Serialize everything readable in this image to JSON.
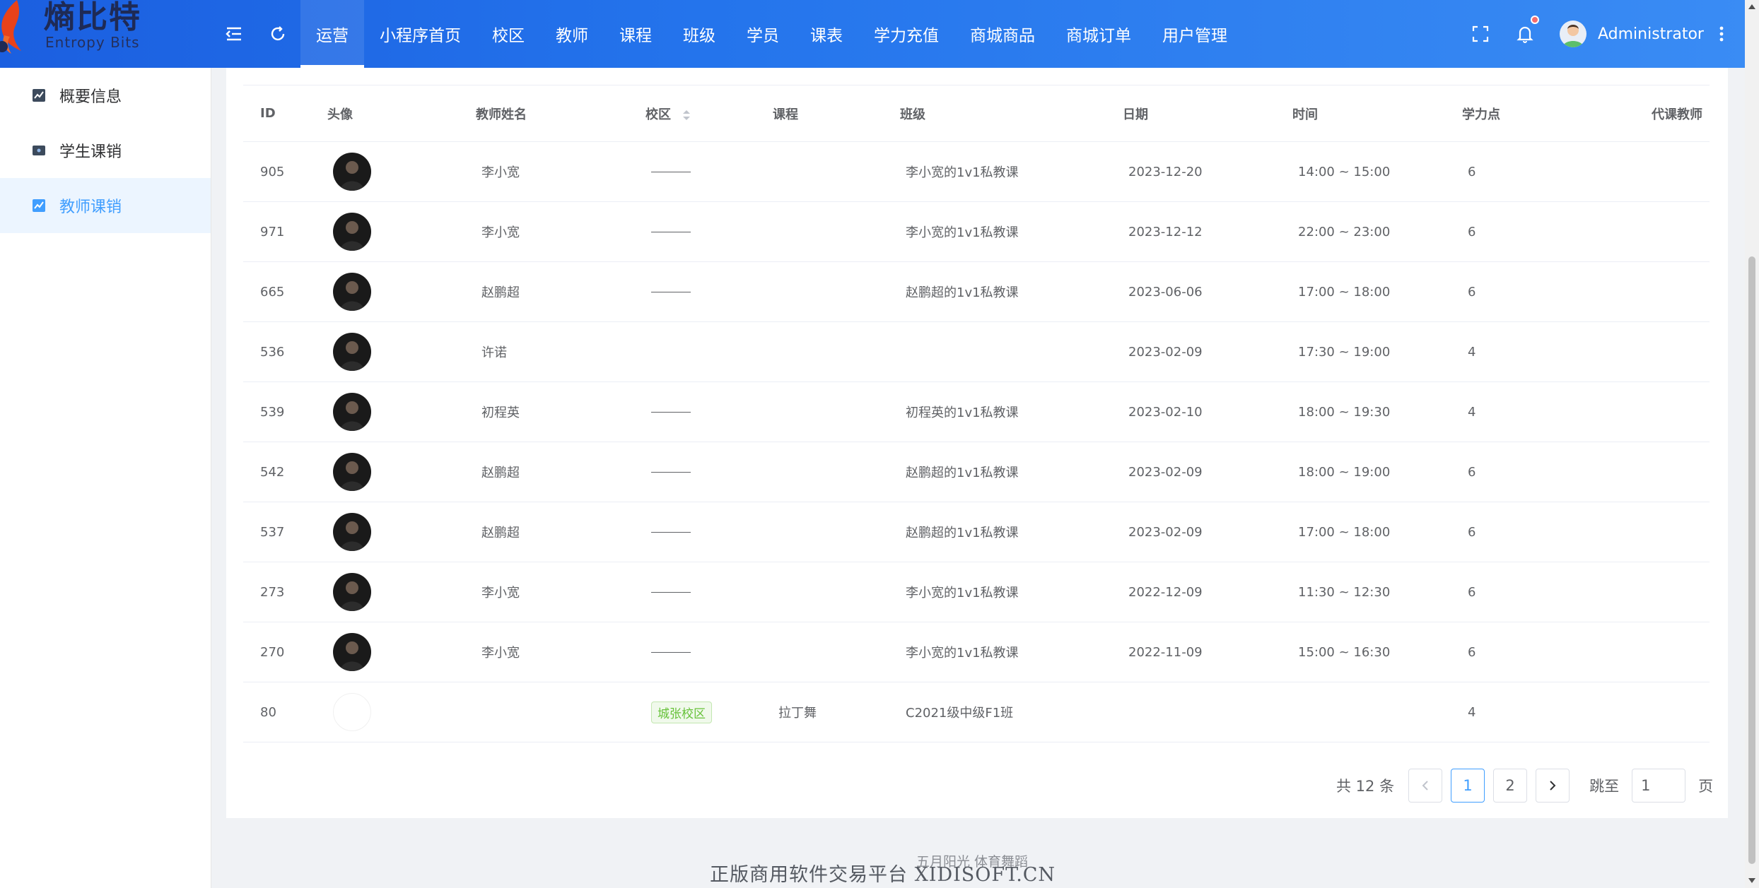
{
  "brand": {
    "title": "熵比特",
    "subtitle": "Entropy Bits"
  },
  "header": {
    "nav": [
      {
        "label": "运营",
        "active": true
      },
      {
        "label": "小程序首页"
      },
      {
        "label": "校区"
      },
      {
        "label": "教师"
      },
      {
        "label": "课程"
      },
      {
        "label": "班级"
      },
      {
        "label": "学员"
      },
      {
        "label": "课表"
      },
      {
        "label": "学力充值"
      },
      {
        "label": "商城商品"
      },
      {
        "label": "商城订单"
      },
      {
        "label": "用户管理"
      }
    ],
    "user_name": "Administrator",
    "icons": [
      "menu-fold-icon",
      "refresh-icon",
      "fullscreen-icon",
      "bell-icon",
      "more-vertical-icon"
    ]
  },
  "sidebar": {
    "items": [
      {
        "label": "概要信息",
        "icon": "trend-chart-icon"
      },
      {
        "label": "学生课销",
        "icon": "id-card-icon"
      },
      {
        "label": "教师课销",
        "icon": "trend-chart-icon",
        "active": true
      }
    ]
  },
  "table": {
    "columns": [
      "ID",
      "头像",
      "教师姓名",
      "校区",
      "课程",
      "班级",
      "日期",
      "时间",
      "学力点",
      "代课教师"
    ],
    "rows": [
      {
        "id": "905",
        "teacher": "李小宽",
        "campus": "———",
        "course": "",
        "class": "李小宽的1v1私教课",
        "date": "2023-12-20",
        "time": "14:00 ~ 15:00",
        "points": "6",
        "substitute": ""
      },
      {
        "id": "971",
        "teacher": "李小宽",
        "campus": "———",
        "course": "",
        "class": "李小宽的1v1私教课",
        "date": "2023-12-12",
        "time": "22:00 ~ 23:00",
        "points": "6",
        "substitute": ""
      },
      {
        "id": "665",
        "teacher": "赵鹏超",
        "campus": "———",
        "course": "",
        "class": "赵鹏超的1v1私教课",
        "date": "2023-06-06",
        "time": "17:00 ~ 18:00",
        "points": "6",
        "substitute": ""
      },
      {
        "id": "536",
        "teacher": "许诺",
        "campus": "",
        "course": "",
        "class": "",
        "date": "2023-02-09",
        "time": "17:30 ~ 19:00",
        "points": "4",
        "substitute": ""
      },
      {
        "id": "539",
        "teacher": "初程英",
        "campus": "———",
        "course": "",
        "class": "初程英的1v1私教课",
        "date": "2023-02-10",
        "time": "18:00 ~ 19:30",
        "points": "4",
        "substitute": ""
      },
      {
        "id": "542",
        "teacher": "赵鹏超",
        "campus": "———",
        "course": "",
        "class": "赵鹏超的1v1私教课",
        "date": "2023-02-09",
        "time": "18:00 ~ 19:00",
        "points": "6",
        "substitute": ""
      },
      {
        "id": "537",
        "teacher": "赵鹏超",
        "campus": "———",
        "course": "",
        "class": "赵鹏超的1v1私教课",
        "date": "2023-02-09",
        "time": "17:00 ~ 18:00",
        "points": "6",
        "substitute": ""
      },
      {
        "id": "273",
        "teacher": "李小宽",
        "campus": "———",
        "course": "",
        "class": "李小宽的1v1私教课",
        "date": "2022-12-09",
        "time": "11:30 ~ 12:30",
        "points": "6",
        "substitute": ""
      },
      {
        "id": "270",
        "teacher": "李小宽",
        "campus": "———",
        "course": "",
        "class": "李小宽的1v1私教课",
        "date": "2022-11-09",
        "time": "15:00 ~ 16:30",
        "points": "6",
        "substitute": ""
      },
      {
        "id": "80",
        "teacher": "",
        "campus": "城张校区",
        "campus_tag": true,
        "course": "拉丁舞",
        "class": "C2021级中级F1班",
        "date": "",
        "time": "",
        "points": "4",
        "substitute": "",
        "avatar_empty": true
      }
    ]
  },
  "pagination": {
    "total_text": "共 12 条",
    "pages": [
      "1",
      "2"
    ],
    "current": "1",
    "jump_label": "跳至",
    "jump_value": "1",
    "page_suffix": "页"
  },
  "footer": {
    "small": "五月阳光 体育舞蹈",
    "watermark": "正版商用软件交易平台 XIDISOFT.CN"
  },
  "colors": {
    "header_start": "#1b5fe0",
    "header_end": "#3a8cf4",
    "accent": "#409eff",
    "tag_green": "#67c23a",
    "notify_dot": "#f56c6c"
  }
}
